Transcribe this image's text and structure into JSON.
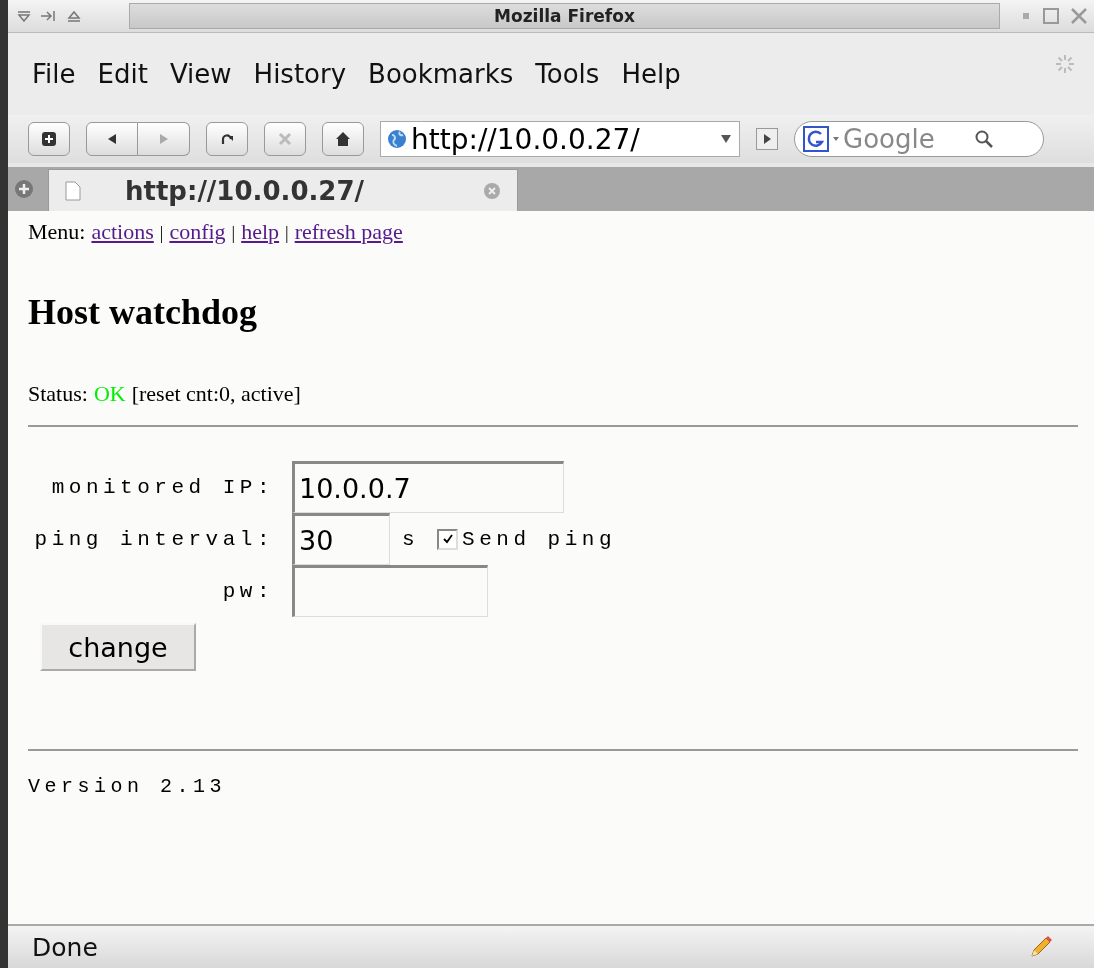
{
  "window": {
    "title": "Mozilla Firefox"
  },
  "menu": [
    "File",
    "Edit",
    "View",
    "History",
    "Bookmarks",
    "Tools",
    "Help"
  ],
  "toolbar": {
    "url": "http://10.0.0.27/",
    "search_placeholder": "Google"
  },
  "tabs": [
    {
      "label": "http://10.0.0.27/",
      "selected": true
    }
  ],
  "page": {
    "menu_label": "Menu:",
    "separator": "|",
    "links": [
      "actions",
      "config",
      "help",
      "refresh page"
    ],
    "heading": "Host watchdog",
    "status_label": "Status:",
    "status_value": "OK",
    "status_detail": "[reset cnt:0, active]",
    "fields": [
      {
        "label": "monitored IP:",
        "value": "10.0.0.7",
        "kind": "ip"
      },
      {
        "label": "ping interval:",
        "value": "30",
        "kind": "interval",
        "unit": "s",
        "checkbox": {
          "label": "Send ping",
          "checked": true
        }
      },
      {
        "label": "pw:",
        "kind": "password"
      }
    ],
    "button": "change",
    "version": "Version 2.13"
  },
  "status_bar": {
    "text": "Done"
  }
}
